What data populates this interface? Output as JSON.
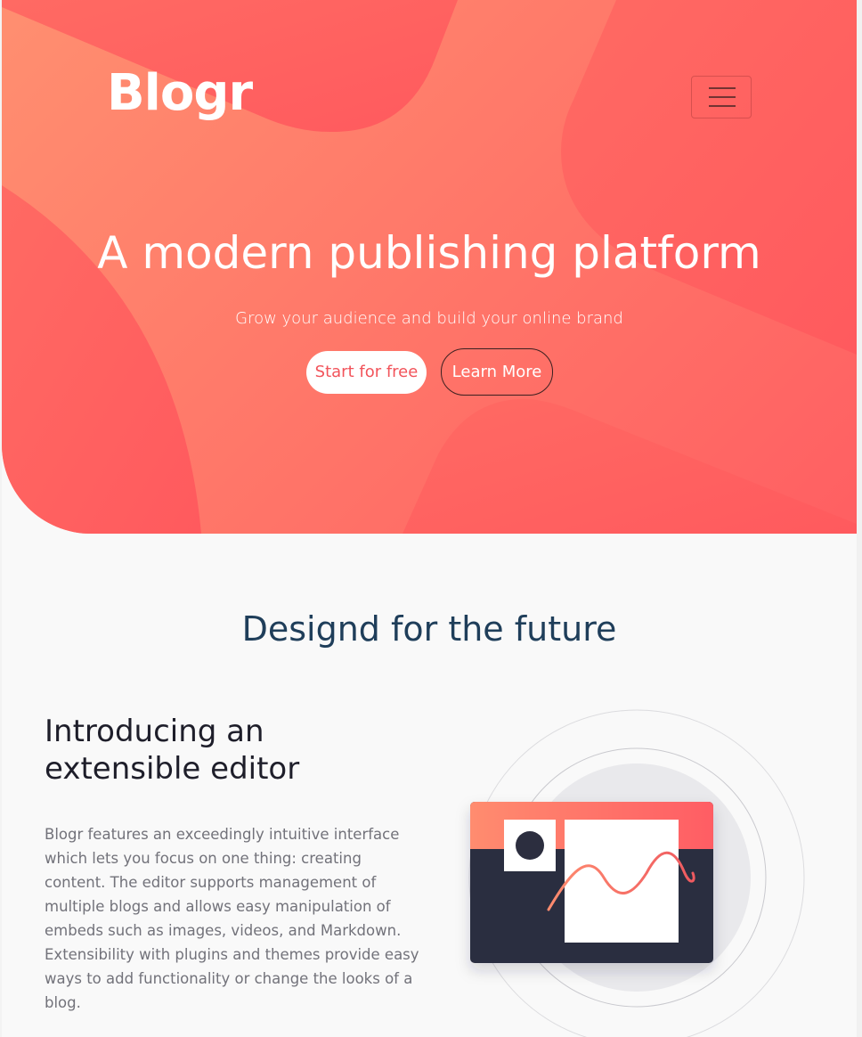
{
  "header": {
    "logo": "Blogr",
    "menu_icon": "hamburger-menu-icon"
  },
  "hero": {
    "title": "A modern publishing platform",
    "subtitle": "Grow your audience and build your online brand",
    "primary_button": "Start for free",
    "secondary_button": "Learn More"
  },
  "section": {
    "title": "Designd for the future"
  },
  "feature": {
    "title": "Introducing an extensible editor",
    "text": "Blogr features an exceedingly intuitive interface which lets you focus on one thing: creating content. The editor supports management of multiple blogs and allows easy manipulation of embeds such as images, videos, and Markdown. Extensibility with plugins and themes provide easy ways to add functionality or change the looks of a blog."
  },
  "colors": {
    "hero_gradient_start": "#ff8f70",
    "hero_gradient_end": "#ff5f62",
    "primary_button_text": "#f2545b",
    "section_title": "#1f3e5a",
    "editor_dark": "#2c2e3f"
  }
}
